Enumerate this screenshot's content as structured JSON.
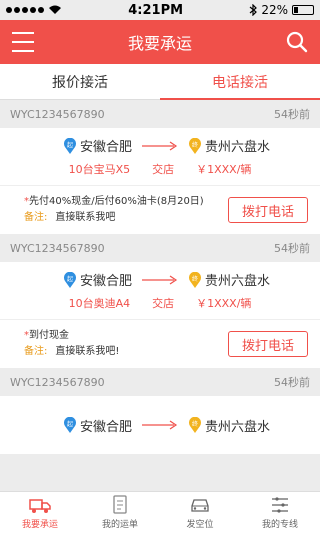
{
  "status": {
    "time": "4:21PM",
    "battery": "22%",
    "battery_level": 0.22
  },
  "header": {
    "title": "我要承运",
    "menu_icon": "menu-icon",
    "search_icon": "search-icon"
  },
  "tabs": [
    {
      "label": "报价接活",
      "active": false
    },
    {
      "label": "电话接活",
      "active": true
    }
  ],
  "orders": [
    {
      "id": "WYC1234567890",
      "time": "54秒前",
      "from": "安徽合肥",
      "to": "贵州六盘水",
      "from_badge": "起",
      "to_badge": "终",
      "vehicle": "10台宝马X5",
      "delivery": "交店",
      "price": "￥1XXX/辆",
      "payment": "先付40%现金/后付60%油卡(8月20日)",
      "remark_label": "备注:",
      "remark": "直接联系我吧",
      "button": "拨打电话"
    },
    {
      "id": "WYC1234567890",
      "time": "54秒前",
      "from": "安徽合肥",
      "to": "贵州六盘水",
      "from_badge": "起",
      "to_badge": "终",
      "vehicle": "10台奥迪A4",
      "delivery": "交店",
      "price": "￥1XXX/辆",
      "payment": "到付现金",
      "remark_label": "备注:",
      "remark": "直接联系我吧!",
      "button": "拨打电话"
    },
    {
      "id": "WYC1234567890",
      "time": "54秒前",
      "from": "安徽合肥",
      "to": "贵州六盘水",
      "from_badge": "起",
      "to_badge": "终"
    }
  ],
  "bottom_nav": [
    {
      "label": "我要承运",
      "icon": "truck-icon",
      "active": true
    },
    {
      "label": "我的运单",
      "icon": "document-icon",
      "active": false
    },
    {
      "label": "发空位",
      "icon": "car-icon",
      "active": false
    },
    {
      "label": "我的专线",
      "icon": "route-list-icon",
      "active": false
    }
  ],
  "colors": {
    "accent": "#f0504a",
    "start_pin": "#2f8fe0",
    "end_pin": "#f2b31f"
  }
}
